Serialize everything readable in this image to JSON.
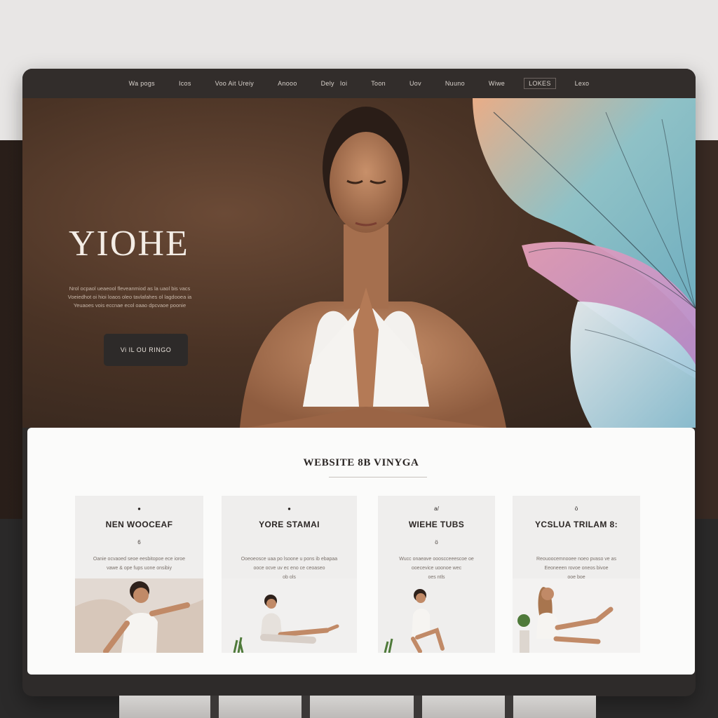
{
  "nav": {
    "items": [
      {
        "label": "Wa pogs"
      },
      {
        "label": "Icos"
      },
      {
        "label": "Voo Ait Ureiy"
      },
      {
        "label": "Anooo"
      },
      {
        "label": "Dely"
      },
      {
        "label": "Ioi"
      },
      {
        "label": "Toon"
      },
      {
        "label": "Uov"
      },
      {
        "label": "Nuuno"
      },
      {
        "label": "Wiwe"
      },
      {
        "label": "LOKES"
      },
      {
        "label": "Lexo"
      }
    ]
  },
  "hero": {
    "title": "YIOHE",
    "lines": [
      "Nrol ocpaol ueaeool fleveanmiod as la uaol bis vacs",
      "Voeiedhot oi hioi loaos oleo tavlafahes ol lagdooea ia",
      "Yeuaoes vois eccnae ecol oaao dpcvaoe poonie"
    ],
    "cta_label": "Vi  IL  OU RINGO"
  },
  "section": {
    "title": "WEBSITE 8B VINYGA"
  },
  "cards": [
    {
      "mark_top": "●",
      "title": "NEN WOOCEAF",
      "mark_mid": "6",
      "lines": [
        "Oanie ocvaoed seoe eesbitopoe ece ioroe",
        "vawe & ope fups uone onsibiy"
      ]
    },
    {
      "mark_top": "●",
      "title": "YORE STAMAI",
      "mark_mid": "",
      "lines": [
        "Ooeoeosce uaa po lsoone u pons ib ebapaa",
        "ooce ocve uv ec eno ce ceoaseo",
        "ob ols"
      ]
    },
    {
      "mark_top": "a/",
      "title": "WIEHE TUBS",
      "mark_mid": "ö",
      "lines": [
        "Wucc onaeave oooscceeescoe oe",
        "ooecevice uoonoe wec",
        "oes ntls"
      ]
    },
    {
      "mark_top": "ö",
      "title": "YCSLUA TRILAM 8:",
      "mark_mid": "",
      "lines": [
        "Reouoocemnooee noeo pvaso ve as",
        "Eeoneeen rovoe oneos bivoe",
        "ooe boe"
      ]
    }
  ],
  "colors": {
    "accent": "#322d2b",
    "hero_bg": "#4a3325",
    "content_bg": "#fbfbfa"
  }
}
